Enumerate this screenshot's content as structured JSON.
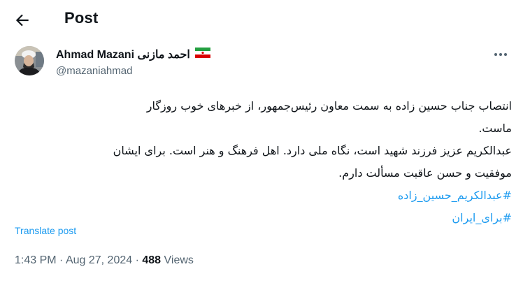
{
  "header": {
    "title": "Post",
    "back_icon": "arrow-left-icon"
  },
  "author": {
    "display_name": "Ahmad Mazani احمد مازنی",
    "flag_icon": "iran-flag-icon",
    "handle": "@mazaniahmad",
    "more_icon": "more-options-icon"
  },
  "tweet": {
    "lines": [
      "انتصاب جناب حسین زاده به سمت معاون رئیس‌جمهور، از خبرهای خوب روزگار",
      "ماست.",
      "عبدالکریم عزیز فرزند شهید است، نگاه ملی دارد. اهل فرهنگ و هنر است. برای ایشان",
      "موفقیت و حسن عاقبت مسألت دارم."
    ],
    "hashtags": [
      "#عبدالکریم_حسین_زاده",
      "#برای_ایران"
    ]
  },
  "translate_label": "Translate post",
  "meta": {
    "time": "1:43 PM",
    "sep": "·",
    "date": "Aug 27, 2024",
    "views_count": "488",
    "views_label": "Views"
  },
  "colors": {
    "link": "#1d9bf0",
    "secondary_text": "#536471",
    "primary_text": "#0f1419"
  }
}
